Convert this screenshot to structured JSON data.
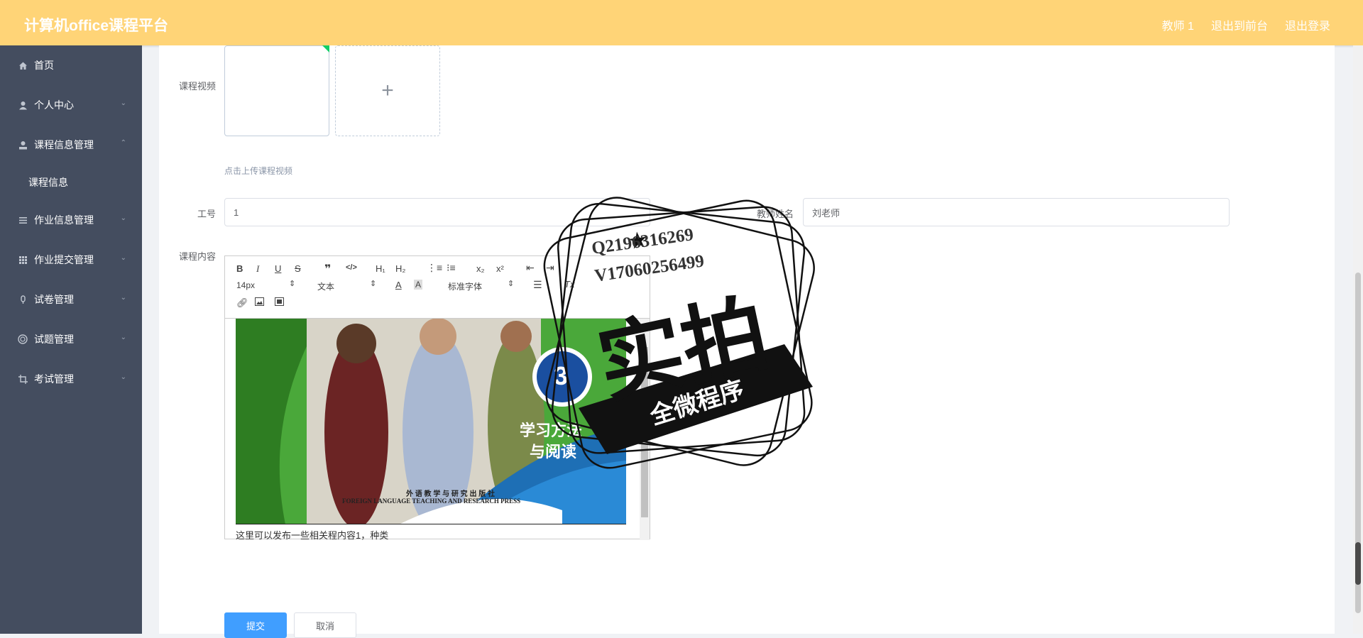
{
  "header": {
    "title": "计算机office课程平台",
    "nav": [
      "教师 1",
      "退出到前台",
      "退出登录"
    ]
  },
  "sidebar": {
    "items": [
      {
        "label": "首页",
        "icon": "home-icon",
        "chevron": ""
      },
      {
        "label": "个人中心",
        "icon": "user-icon",
        "chevron": "⌄"
      },
      {
        "label": "课程信息管理",
        "icon": "user-icon",
        "chevron": "⌃"
      },
      {
        "label": "课程信息",
        "sub": true
      },
      {
        "label": "作业信息管理",
        "icon": "list-icon",
        "chevron": "⌄"
      },
      {
        "label": "作业提交管理",
        "icon": "grid-icon",
        "chevron": "⌄"
      },
      {
        "label": "试卷管理",
        "icon": "mic-icon",
        "chevron": "⌄"
      },
      {
        "label": "试题管理",
        "icon": "circle-icon",
        "chevron": "⌄"
      },
      {
        "label": "考试管理",
        "icon": "crop-icon",
        "chevron": "⌄"
      }
    ]
  },
  "form": {
    "video_label": "课程视频",
    "upload_hint": "点击上传课程视频",
    "plus": "+",
    "id_label": "工号",
    "id_value": "1",
    "teacher_label": "教师姓名",
    "teacher_value": "刘老师",
    "content_label": "课程内容",
    "submit_label": "提交",
    "cancel_label": "取消"
  },
  "editor": {
    "font_size": "14px",
    "header_select": "文本",
    "font_family": "标准字体",
    "text": "这里可以发布一些相关程内容1，种类",
    "cover_title_1": "学习方法",
    "cover_title_2": "与阅读",
    "cover_num": "3",
    "publisher_cn": "外 语 教 学 与 研 究 出 版 社",
    "publisher_en": "FOREIGN LANGUAGE TEACHING AND RESEARCH PRESS"
  },
  "watermark": {
    "line1": "Q2196316269",
    "line2": "V17060256499",
    "big": "实拍",
    "banner": "全微程序"
  }
}
